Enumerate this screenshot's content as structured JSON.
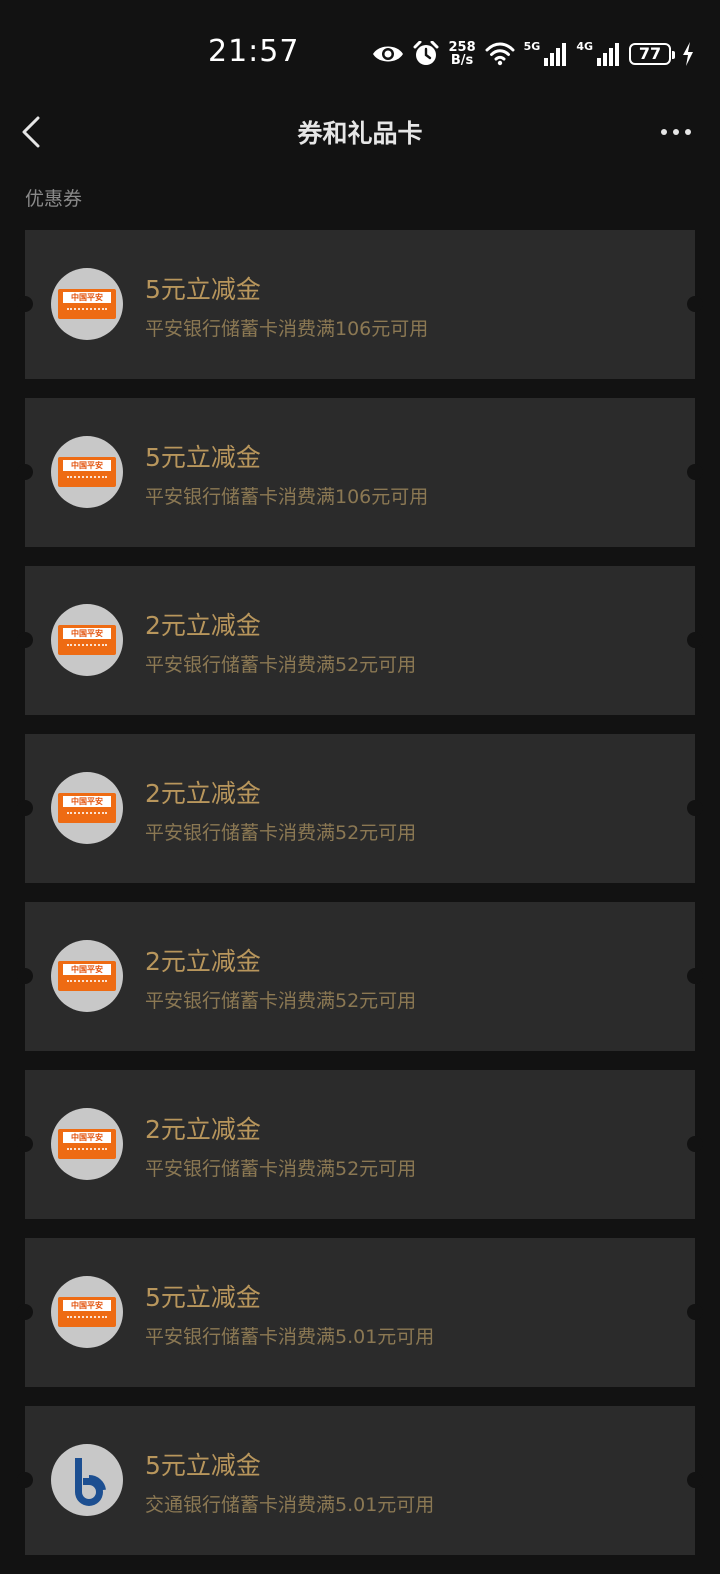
{
  "status": {
    "time": "21:57",
    "net_speed_top": "258",
    "net_speed_bottom": "B/s",
    "sig1_label": "5G",
    "sig2_label": "4G",
    "battery": "77"
  },
  "header": {
    "title": "券和礼品卡"
  },
  "section": {
    "label": "优惠券"
  },
  "pingan_logo_text": "中国平安",
  "coupons": [
    {
      "title": "5元立减金",
      "desc": "平安银行储蓄卡消费满106元可用",
      "bank": "pingan"
    },
    {
      "title": "5元立减金",
      "desc": "平安银行储蓄卡消费满106元可用",
      "bank": "pingan"
    },
    {
      "title": "2元立减金",
      "desc": "平安银行储蓄卡消费满52元可用",
      "bank": "pingan"
    },
    {
      "title": "2元立减金",
      "desc": "平安银行储蓄卡消费满52元可用",
      "bank": "pingan"
    },
    {
      "title": "2元立减金",
      "desc": "平安银行储蓄卡消费满52元可用",
      "bank": "pingan"
    },
    {
      "title": "2元立减金",
      "desc": "平安银行储蓄卡消费满52元可用",
      "bank": "pingan"
    },
    {
      "title": "5元立减金",
      "desc": "平安银行储蓄卡消费满5.01元可用",
      "bank": "pingan"
    },
    {
      "title": "5元立减金",
      "desc": "交通银行储蓄卡消费满5.01元可用",
      "bank": "bocom"
    }
  ],
  "colors": {
    "background": "#121212",
    "card": "#2b2b2b",
    "title_gold": "#b8965c",
    "desc_gold": "#8b7853",
    "pingan_orange": "#ee6b13",
    "bocom_blue": "#1d4f91"
  }
}
